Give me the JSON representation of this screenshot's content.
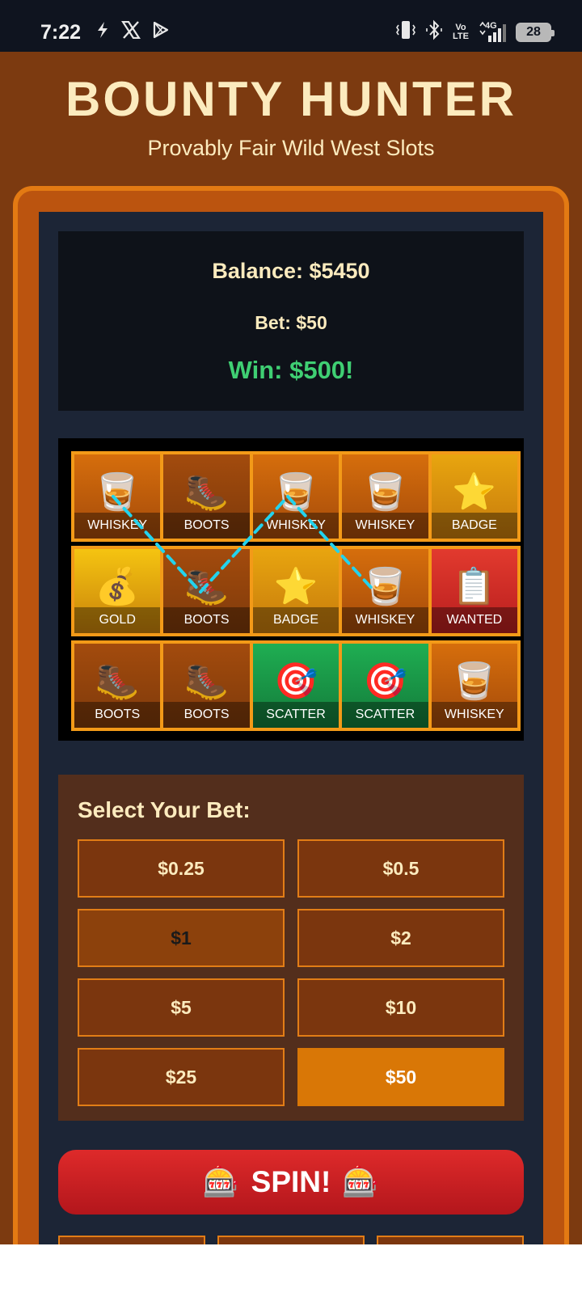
{
  "status_bar": {
    "time": "7:22",
    "left_icons": [
      "lightning-icon",
      "x-logo-icon",
      "play-store-icon"
    ],
    "right_icons": [
      "vibrate-icon",
      "bluetooth-icon",
      "volte-icon",
      "signal-4g-icon",
      "battery-icon"
    ],
    "volte_line1": "Vo",
    "volte_line2": "LTE",
    "network": "4G",
    "battery": "28"
  },
  "header": {
    "title": "BOUNTY HUNTER",
    "subtitle": "Provably Fair Wild West Slots"
  },
  "stats": {
    "balance": "Balance: $5450",
    "bet": "Bet: $50",
    "win": "Win: $500!"
  },
  "reels": {
    "rows": [
      [
        {
          "symbol": "🥃",
          "label": "WHISKEY",
          "color": "#d66e0c"
        },
        {
          "symbol": "🥾",
          "label": "BOOTS",
          "color": "#a34b0d"
        },
        {
          "symbol": "🥃",
          "label": "WHISKEY",
          "color": "#d66e0c"
        },
        {
          "symbol": "🥃",
          "label": "WHISKEY",
          "color": "#d66e0c"
        },
        {
          "symbol": "⭐",
          "label": "BADGE",
          "color": "#e8a50f"
        }
      ],
      [
        {
          "symbol": "💰",
          "label": "GOLD",
          "color": "#f5c411"
        },
        {
          "symbol": "🥾",
          "label": "BOOTS",
          "color": "#a34b0d"
        },
        {
          "symbol": "⭐",
          "label": "BADGE",
          "color": "#e8a50f"
        },
        {
          "symbol": "🥃",
          "label": "WHISKEY",
          "color": "#d66e0c"
        },
        {
          "symbol": "📋",
          "label": "WANTED",
          "color": "#e23a2e"
        }
      ],
      [
        {
          "symbol": "🥾",
          "label": "BOOTS",
          "color": "#a34b0d"
        },
        {
          "symbol": "🥾",
          "label": "BOOTS",
          "color": "#a34b0d"
        },
        {
          "symbol": "🎯",
          "label": "SCATTER",
          "color": "#1fae52"
        },
        {
          "symbol": "🎯",
          "label": "SCATTER",
          "color": "#1fae52"
        },
        {
          "symbol": "🥃",
          "label": "WHISKEY",
          "color": "#d66e0c"
        }
      ]
    ],
    "payline_color": "#22d3ee"
  },
  "bets": {
    "title": "Select Your Bet:",
    "options": [
      "$0.25",
      "$0.5",
      "$1",
      "$2",
      "$5",
      "$10",
      "$25",
      "$50"
    ],
    "selected": "$50",
    "selected_color": "#d97706"
  },
  "spin": {
    "icon": "🎰",
    "label": "SPIN!"
  }
}
